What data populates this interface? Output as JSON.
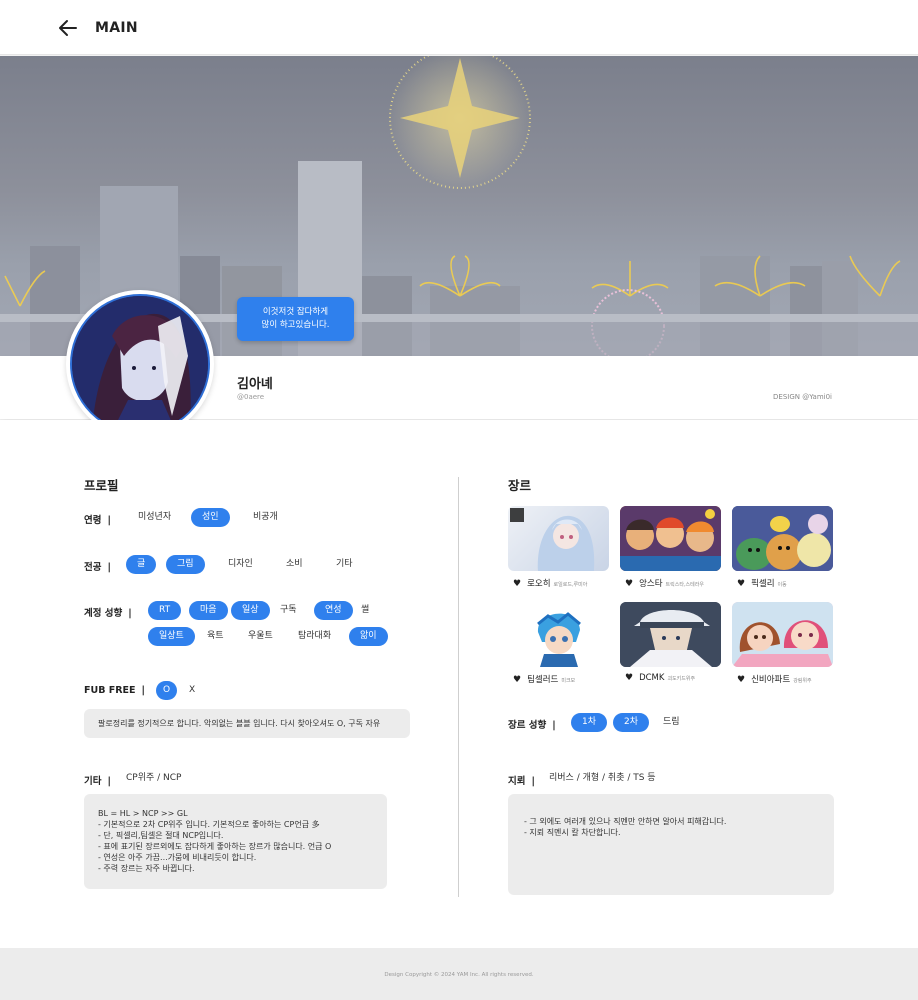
{
  "header": {
    "title": "MAIN"
  },
  "profile": {
    "bubble_line1": "이것저것 잡다하게",
    "bubble_line2": "많이 하고있습니다.",
    "name": "김아녜",
    "handle": "@0aere",
    "design_credit": "DESIGN @Yami0i"
  },
  "left": {
    "section_title": "프로필",
    "age": {
      "label": "연령",
      "sep": "|",
      "options": [
        "미성년자",
        "성인",
        "비공개"
      ]
    },
    "major": {
      "label": "전공",
      "sep": "|",
      "options": [
        "글",
        "그림",
        "디자인",
        "소비",
        "기타"
      ]
    },
    "account": {
      "label": "계정 성향",
      "sep": "|",
      "options_row1": [
        "RT",
        "마음",
        "일상",
        "구독",
        "연성",
        "썰"
      ],
      "options_row2": [
        "일상트",
        "육트",
        "우울트",
        "탐라대화",
        "앎이"
      ]
    },
    "fub": {
      "label": "FUB FREE",
      "sep": "|",
      "options": [
        "O",
        "X"
      ],
      "note": "팔로정리를 정기적으로 합니다. 악의없는 블블 입니다. 다시 찾아오셔도 O, 구독 자유"
    },
    "etc": {
      "label": "기타",
      "sep": "|",
      "value": "CP위주 / NCP",
      "lines": [
        "BL = HL > NCP >> GL",
        "- 기본적으로 2차 CP위주 입니다.  기본적으로 좋아하는 CP언급 多",
        "- 단, 픽셀리,팀셀은 절대 NCP입니다.",
        "- 표에 표기된 장르외에도 잡다하게 좋아하는 장르가 많습니다. 언급 O",
        "- 연성은 아주 가끔...가뭄에 비내리듯이 합니다.",
        "- 주력 장르는 자주 바뀝니다."
      ]
    }
  },
  "right": {
    "section_title": "장르",
    "genres": [
      {
        "name": "로오히",
        "sub": "로일로드,루미아"
      },
      {
        "name": "앙스타",
        "sub": "트릭스타,스테라우"
      },
      {
        "name": "픽셀리",
        "sub": "이동"
      },
      {
        "name": "팀셀러드",
        "sub": "미크모"
      },
      {
        "name": "DCMK",
        "sub": "괴도키드위주"
      },
      {
        "name": "신비아파트",
        "sub": "강림위주"
      }
    ],
    "genre_pref": {
      "label": "장르 성향",
      "sep": "|",
      "options": [
        "1차",
        "2차",
        "드림"
      ]
    },
    "mine": {
      "label": "지뢰",
      "sep": "|",
      "value": "리버스 / 개형 / 취촛 / TS 등",
      "lines": [
        "- 그 외에도 여러개 있으나 직멘만 안하면 알아서 피해갑니다.",
        "- 지뢰 직멘시 칼 차단합니다."
      ]
    }
  },
  "footer": {
    "text": "Design Copyright © 2024 YAM Inc. All rights reserved."
  },
  "colors": {
    "accent": "#2f80ed",
    "note_bg": "#ececec"
  }
}
